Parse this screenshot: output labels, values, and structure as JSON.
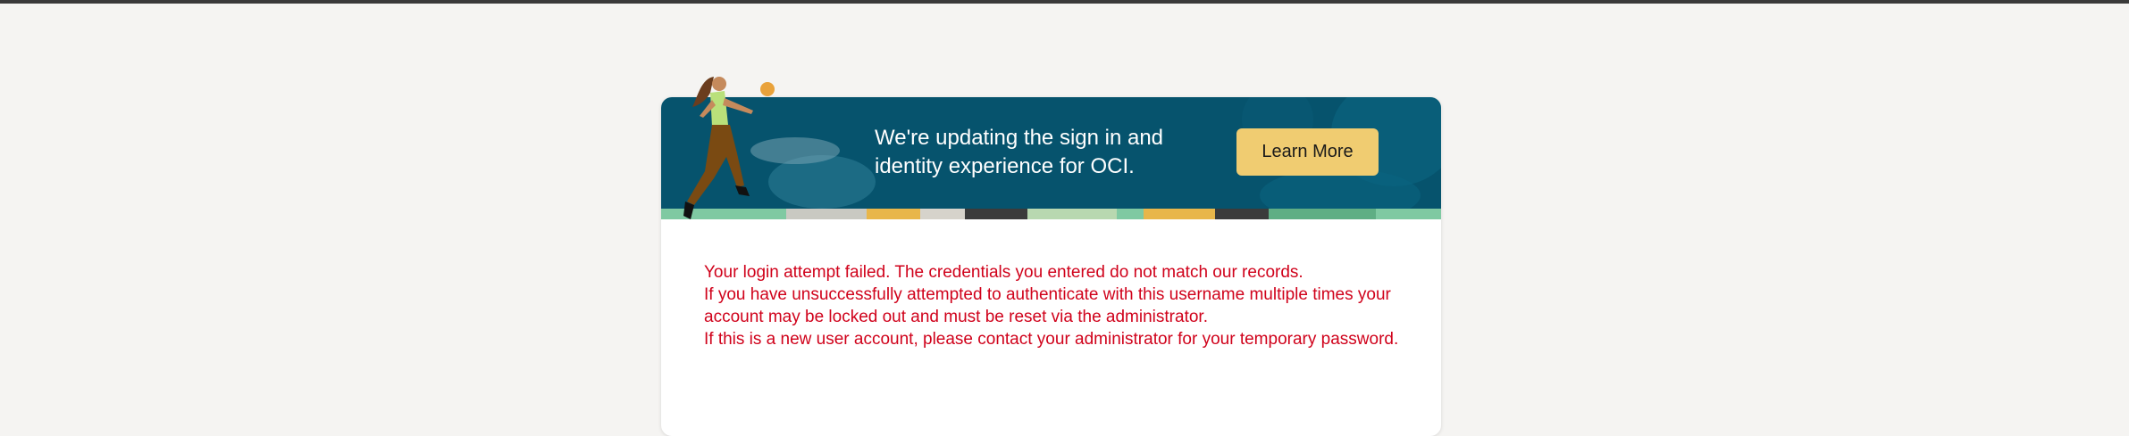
{
  "banner": {
    "message": "We're updating the sign in and identity experience for OCI.",
    "learn_more_label": "Learn More"
  },
  "errors": [
    "Your login attempt failed. The credentials you entered do not match our records.",
    "If you have unsuccessfully attempted to authenticate with this username multiple times your account may be locked out and must be reset via the administrator.",
    "If this is a new user account, please contact your administrator for your temporary password."
  ],
  "colors": {
    "banner_bg": "#06536d",
    "button_bg": "#f0cc71",
    "error_text": "#d0021b",
    "page_bg": "#f5f4f2"
  }
}
